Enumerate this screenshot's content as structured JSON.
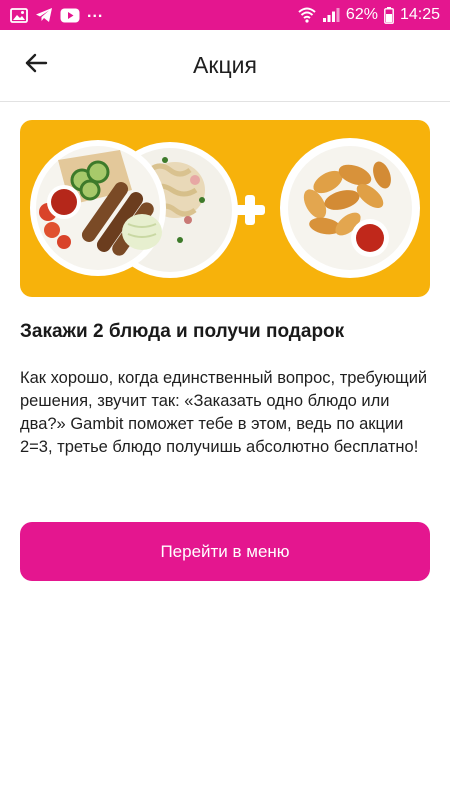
{
  "status_bar": {
    "left_icons": [
      "gallery-icon",
      "telegram-icon",
      "youtube-icon"
    ],
    "more_indicator": "...",
    "right_icons": [
      "wifi-icon",
      "signal-icon",
      "battery-icon"
    ],
    "battery": "62%",
    "time": "14:25"
  },
  "header": {
    "title": "Акция",
    "back_icon": "arrow-left-icon"
  },
  "banner": {
    "image_name": "promo-banner-image",
    "plus_icon": "plus-icon"
  },
  "promo": {
    "heading": "Закажи 2 блюда и получи подарок",
    "description": "Как хорошо, когда единственный вопрос, требующий решения, звучит так: «Заказать одно блюдо или два?» Gambit поможет тебе в этом, ведь по акции 2=3, третье блюдо получишь абсолютно бесплатно!"
  },
  "cta": {
    "label": "Перейти в меню"
  },
  "colors": {
    "accent": "#e4168f",
    "banner_background": "#f7b20b"
  }
}
